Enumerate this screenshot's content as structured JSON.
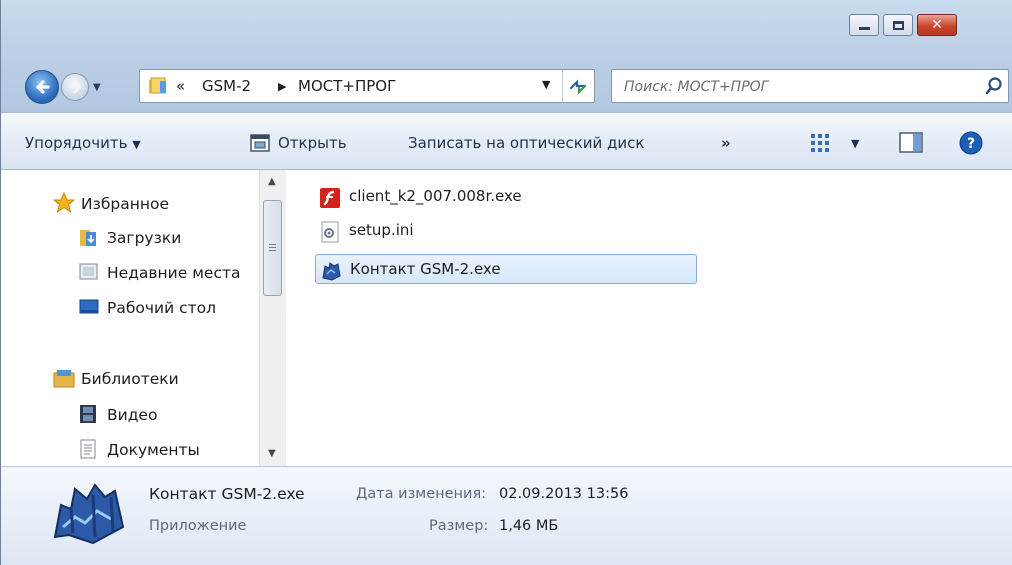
{
  "window": {
    "caption_buttons": [
      "minimize",
      "maximize",
      "close"
    ]
  },
  "address_bar": {
    "overflow_chevron": "«",
    "segments": [
      "GSM-2",
      "МОСТ+ПРОГ"
    ],
    "separator": "▶",
    "dropdown_arrow": "▼"
  },
  "search": {
    "placeholder": "Поиск: МОСТ+ПРОГ"
  },
  "toolbar": {
    "organize": "Упорядочить",
    "open": "Открыть",
    "burn": "Записать на оптический диск",
    "more": "»",
    "caret": "▼"
  },
  "nav_pane": {
    "favorites_header": "Избранное",
    "favorites": [
      "Загрузки",
      "Недавние места",
      "Рабочий стол"
    ],
    "libraries_header": "Библиотеки",
    "libraries": [
      "Видео",
      "Документы"
    ]
  },
  "files": [
    {
      "name": "client_k2_007.008r.exe",
      "icon": "flash-exe-icon",
      "selected": false
    },
    {
      "name": "setup.ini",
      "icon": "ini-settings-icon",
      "selected": false
    },
    {
      "name": "Контакт GSM-2.exe",
      "icon": "app-exe-icon",
      "selected": true
    }
  ],
  "details": {
    "name": "Контакт GSM-2.exe",
    "type": "Приложение",
    "modified_label": "Дата изменения:",
    "modified_value": "02.09.2013 13:56",
    "size_label": "Размер:",
    "size_value": "1,46 МБ"
  },
  "colors": {
    "frame": "#bcd0e6",
    "selection_fill": "#d6e8fb",
    "selection_border": "#84acdd",
    "close_button": "#c9462c"
  }
}
